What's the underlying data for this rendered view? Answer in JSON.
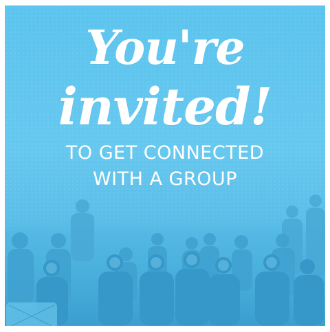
{
  "invite": {
    "line1": "You're",
    "line2": "invited!",
    "line3": "TO GET CONNECTED",
    "line4": "WITH A GROUP"
  },
  "colors": {
    "background": "#5cc4ee",
    "text": "#ffffff",
    "photo_tint": "#3aa6d6"
  }
}
